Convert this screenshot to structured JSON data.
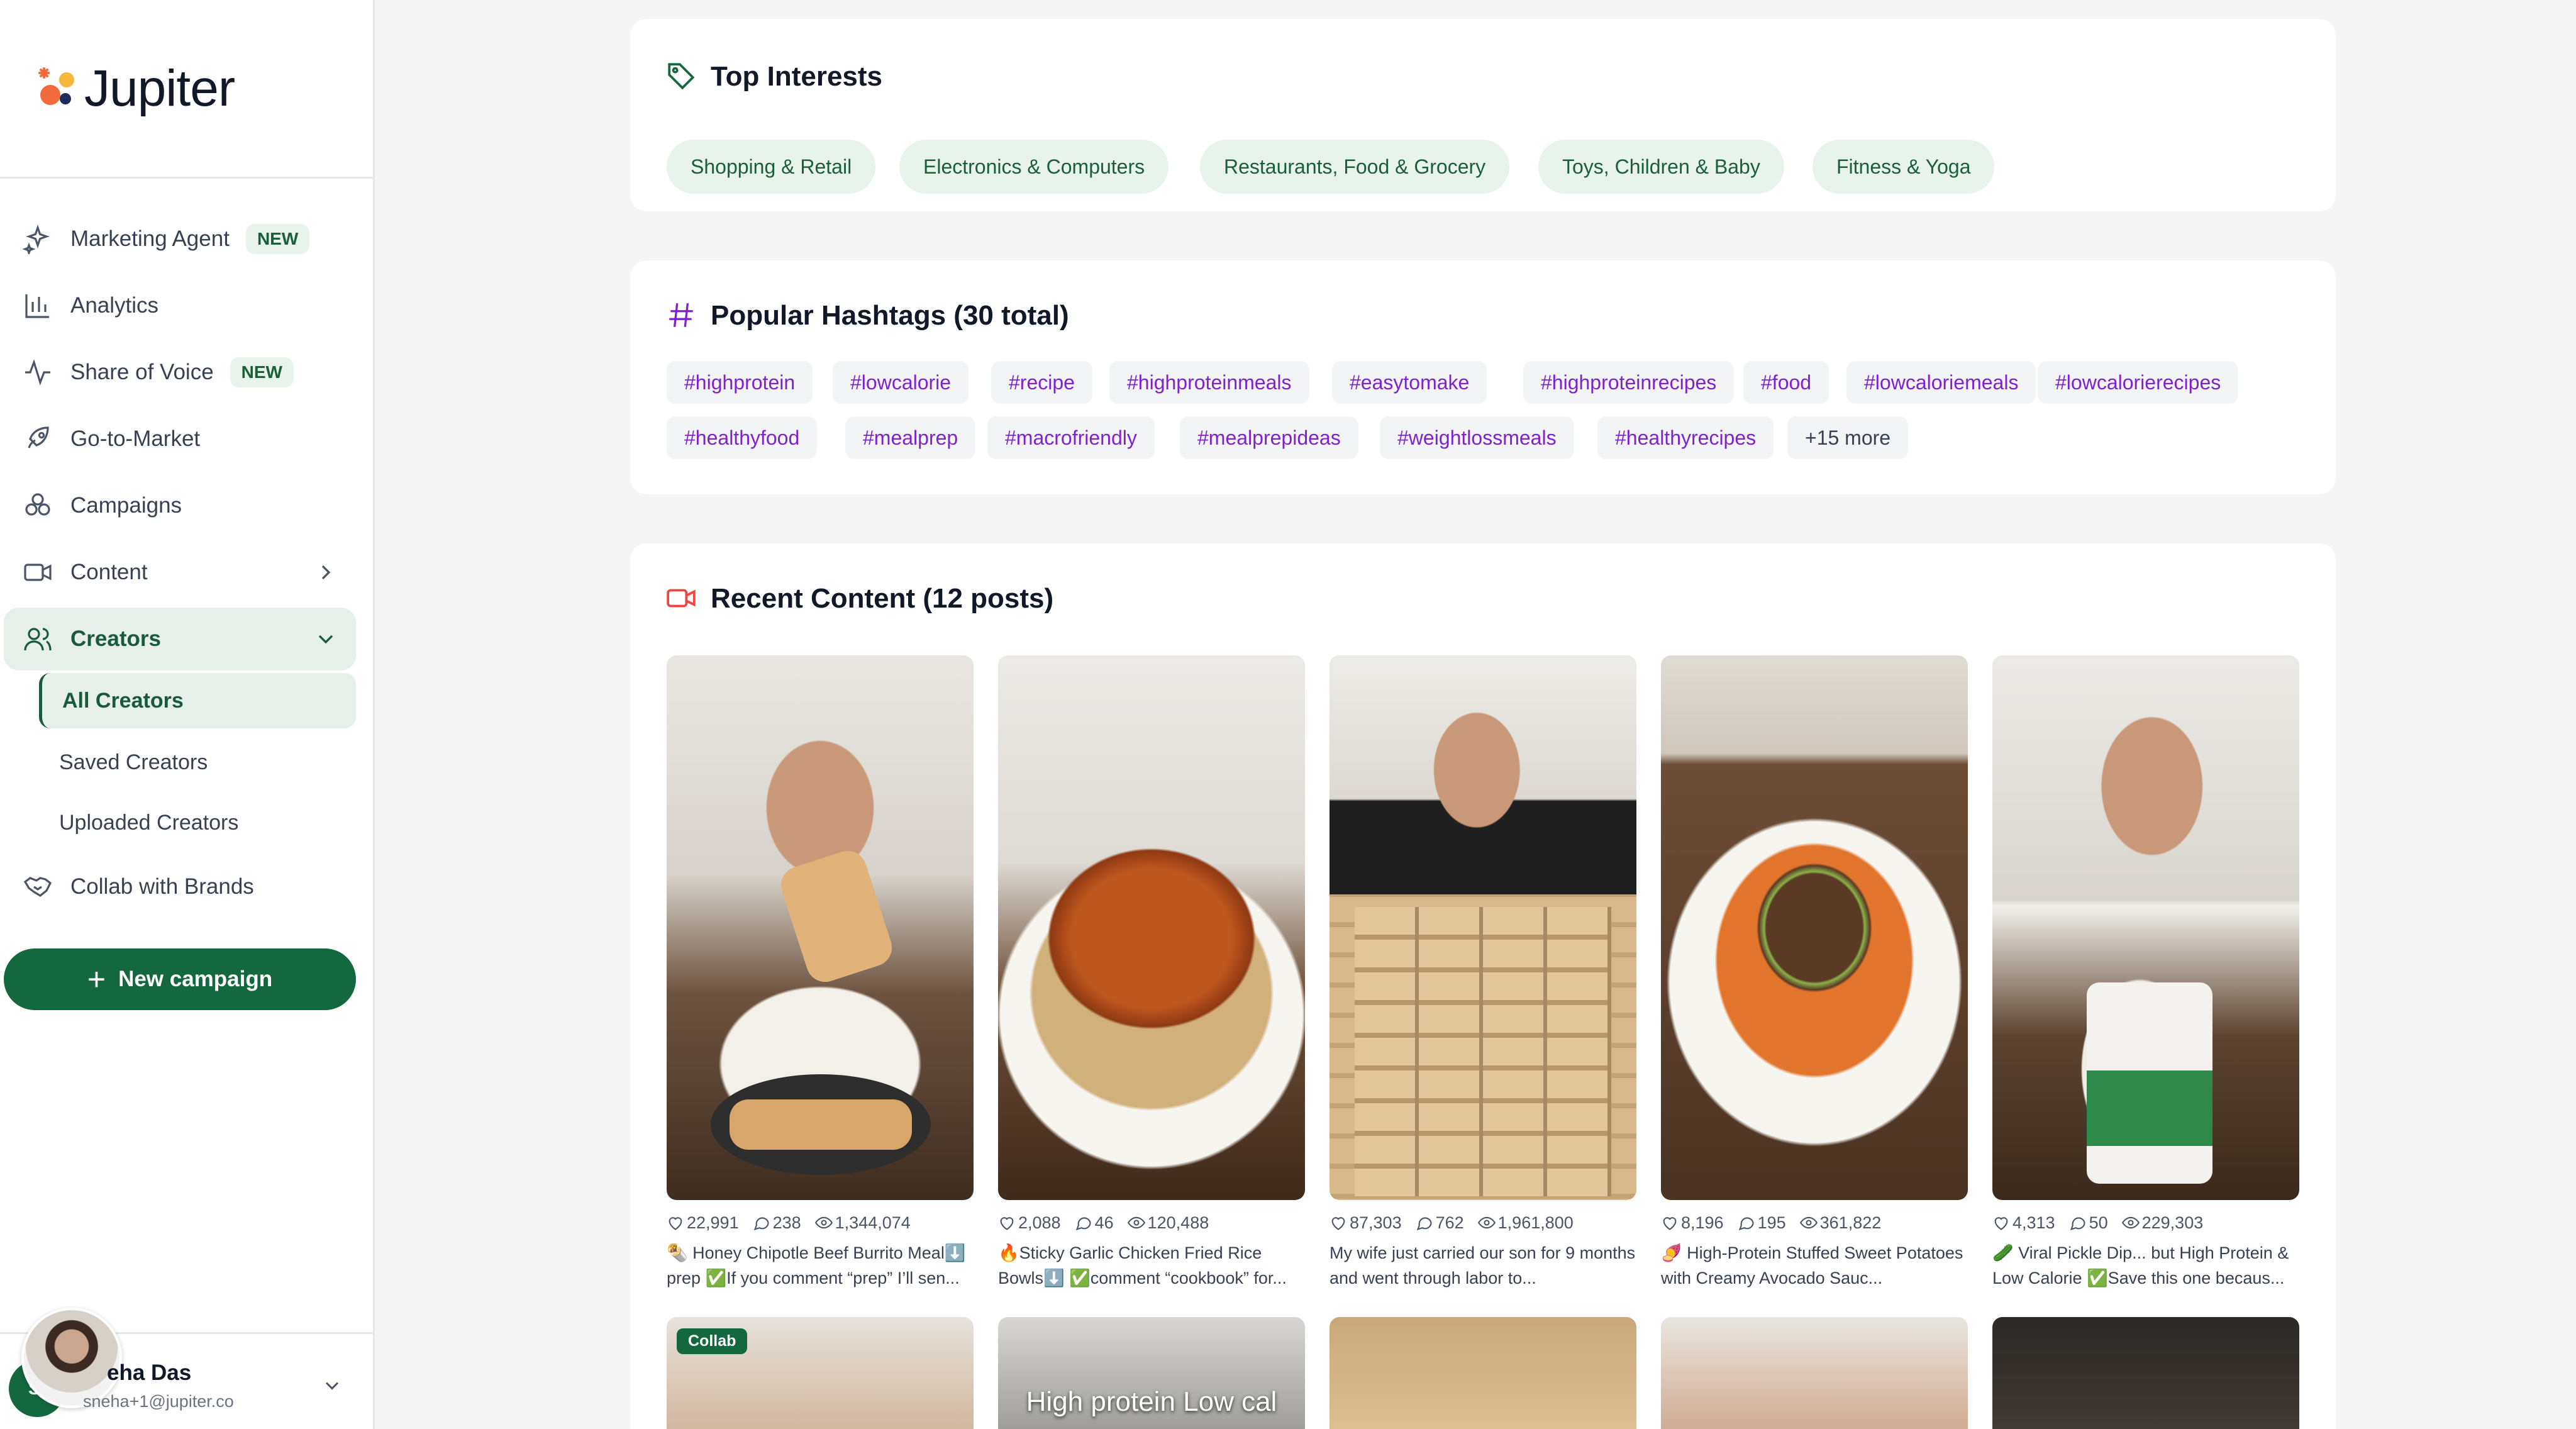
{
  "app": {
    "name": "Jupiter"
  },
  "sidebar": {
    "items": [
      {
        "label": "Marketing Agent",
        "badge": "NEW",
        "icon": "sparkles-icon"
      },
      {
        "label": "Analytics",
        "icon": "bar-chart-icon"
      },
      {
        "label": "Share of Voice",
        "badge": "NEW",
        "icon": "activity-icon"
      },
      {
        "label": "Go-to-Market",
        "icon": "rocket-icon"
      },
      {
        "label": "Campaigns",
        "icon": "campaigns-icon"
      },
      {
        "label": "Content",
        "icon": "video-icon"
      },
      {
        "label": "Creators",
        "icon": "users-icon"
      },
      {
        "label": "Collab with Brands",
        "icon": "handshake-icon"
      }
    ],
    "creators_subitems": [
      {
        "label": "All Creators"
      },
      {
        "label": "Saved Creators"
      },
      {
        "label": "Uploaded Creators"
      }
    ],
    "new_campaign_label": "New campaign",
    "user": {
      "initials": "SI",
      "name": "Sneha Das",
      "name_visible": "eha Das",
      "email": "sneha+1@jupiter.co"
    }
  },
  "top_interests": {
    "title": "Top Interests",
    "items": [
      "Shopping & Retail",
      "Electronics & Computers",
      "Restaurants, Food & Grocery",
      "Toys, Children & Baby",
      "Fitness & Yoga"
    ]
  },
  "hashtags": {
    "title": "Popular Hashtags (30 total)",
    "row1": [
      "#highprotein",
      "#lowcalorie",
      "#recipe",
      "#highproteinmeals",
      "#easytomake",
      "#highproteinrecipes",
      "#food",
      "#lowcaloriemeals",
      "#lowcalorierecipes"
    ],
    "row2": [
      "#healthyfood",
      "#mealprep",
      "#macrofriendly",
      "#mealprepideas",
      "#weightlossmeals",
      "#healthyrecipes"
    ],
    "more": "+15 more"
  },
  "recent_content": {
    "title": "Recent Content (12 posts)",
    "posts": [
      {
        "likes": "22,991",
        "comments": "238",
        "views": "1,344,074",
        "caption": "🌯 Honey Chipotle Beef Burrito Meal⬇️ prep ✅If you comment “prep” I’ll sen..."
      },
      {
        "likes": "2,088",
        "comments": "46",
        "views": "120,488",
        "caption": "🔥Sticky Garlic Chicken Fried Rice Bowls⬇️ ✅comment “cookbook” for..."
      },
      {
        "likes": "87,303",
        "comments": "762",
        "views": "1,961,800",
        "caption": "My wife just carried our son for 9 months and went through labor to..."
      },
      {
        "likes": "8,196",
        "comments": "195",
        "views": "361,822",
        "caption": "🍠 High-Protein Stuffed Sweet Potatoes with Creamy Avocado Sauc..."
      },
      {
        "likes": "4,313",
        "comments": "50",
        "views": "229,303",
        "caption": "🥒 Viral Pickle Dip... but High Protein & Low Calorie ✅Save this one becaus..."
      }
    ],
    "second_row": {
      "collab_label": "Collab",
      "overlay_text": "High protein Low cal"
    }
  },
  "colors": {
    "brand_green": "#14683f",
    "pill_bg": "#e8f3ec",
    "hashtag_text": "#7e22ce",
    "accent_red": "#ef4444"
  }
}
